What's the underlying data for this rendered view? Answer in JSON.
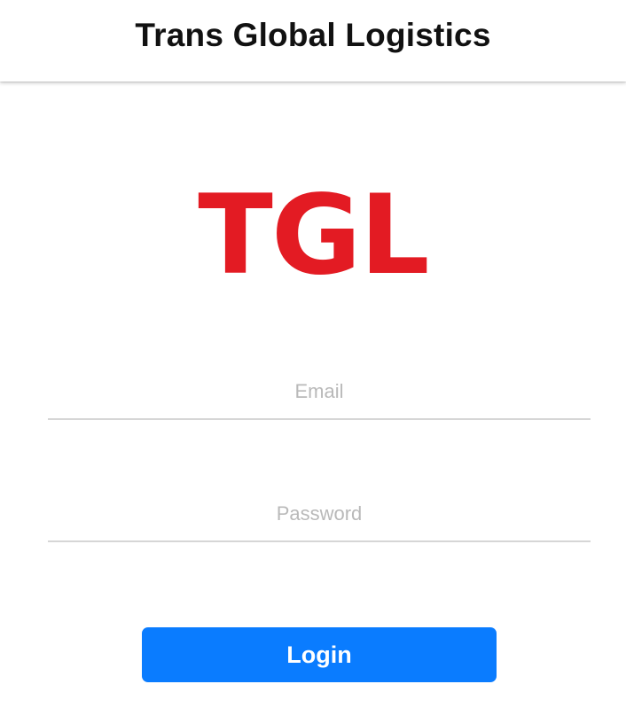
{
  "header": {
    "title": "Trans Global Logistics"
  },
  "logo": {
    "text": "TGL",
    "color": "#e31b23"
  },
  "form": {
    "email": {
      "placeholder": "Email",
      "value": ""
    },
    "password": {
      "placeholder": "Password",
      "value": ""
    },
    "login_label": "Login"
  },
  "colors": {
    "accent": "#0a7cff",
    "logo_red": "#e31b23",
    "field_underline": "#d6d6d6",
    "placeholder": "#b9b9b9"
  }
}
